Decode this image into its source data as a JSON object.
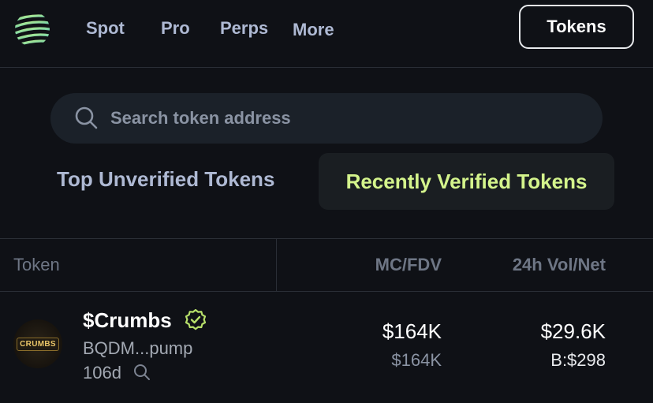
{
  "nav": {
    "items": [
      {
        "label": "Spot"
      },
      {
        "label": "Pro"
      },
      {
        "label": "Perps"
      },
      {
        "label": "More"
      }
    ],
    "tokens_button": "Tokens"
  },
  "search": {
    "placeholder": "Search token address",
    "value": ""
  },
  "tabs": [
    {
      "label": "Top Unverified Tokens",
      "active": false
    },
    {
      "label": "Recently Verified Tokens",
      "active": true
    }
  ],
  "table": {
    "columns": [
      "Token",
      "MC/FDV",
      "24h Vol/Net"
    ],
    "rows": [
      {
        "name": "$Crumbs",
        "verified": true,
        "logo_text": "CRUMBS",
        "address": "BQDM...pump",
        "age": "106d",
        "mc": "$164K",
        "fdv": "$164K",
        "vol": "$29.6K",
        "net": "B:$298"
      }
    ]
  },
  "colors": {
    "background": "#0f1116",
    "accent_green": "#d4f48c",
    "nav_text": "#aeb9d3",
    "verified_badge": "#b7e06a"
  }
}
